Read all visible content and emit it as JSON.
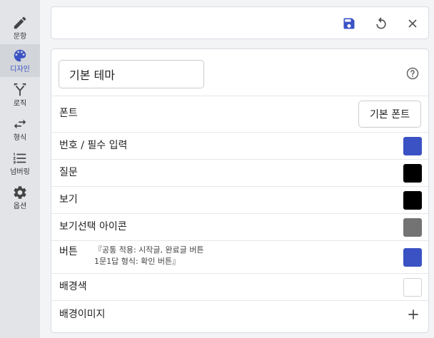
{
  "sidebar": {
    "items": [
      {
        "label": "문항",
        "icon": "pencil-icon",
        "active": false
      },
      {
        "label": "디자인",
        "icon": "palette-icon",
        "active": true
      },
      {
        "label": "로직",
        "icon": "branch-icon",
        "active": false
      },
      {
        "label": "형식",
        "icon": "swap-arrows-icon",
        "active": false
      },
      {
        "label": "넘버링",
        "icon": "numbered-list-icon",
        "active": false
      },
      {
        "label": "옵션",
        "icon": "gear-icon",
        "active": false
      }
    ]
  },
  "toolbar": {
    "save_icon": "save-icon",
    "reset_icon": "reset-icon",
    "close_icon": "close-icon"
  },
  "theme": {
    "name_value": "기본 테마",
    "help_icon": "help-icon"
  },
  "rows": {
    "font": {
      "label": "폰트",
      "button_label": "기본 폰트"
    },
    "number_required": {
      "label": "번호 / 필수 입력",
      "color": "#3b52c4"
    },
    "question": {
      "label": "질문",
      "color": "#000000"
    },
    "options": {
      "label": "보기",
      "color": "#000000"
    },
    "option_select_icon": {
      "label": "보기선택 아이콘",
      "color": "#737373"
    },
    "button": {
      "label": "버튼",
      "note_line1": "『공통 적용: 시작글, 완료글 버튼",
      "note_line2": "1문1답 형식: 확인 버튼』",
      "color": "#3b52c4"
    },
    "background_color": {
      "label": "배경색",
      "color": "#ffffff"
    },
    "background_image": {
      "label": "배경이미지",
      "add_icon": "plus-icon"
    }
  },
  "colors": {
    "accent": "#3b52c4",
    "sidebar_active_bg": "#d2d5da"
  }
}
